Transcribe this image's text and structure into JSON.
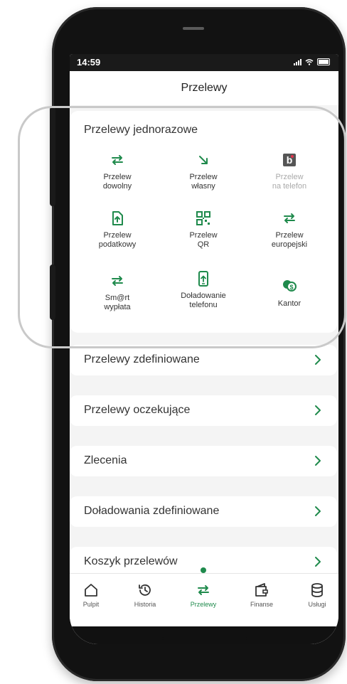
{
  "status": {
    "time": "14:59"
  },
  "header": {
    "title": "Przelewy"
  },
  "one_time": {
    "title": "Przelewy jednorazowe",
    "tiles": [
      {
        "line1": "Przelew",
        "line2": "dowolny",
        "icon": "arrows-exchange-icon",
        "enabled": true
      },
      {
        "line1": "Przelew",
        "line2": "własny",
        "icon": "arrow-down-right-icon",
        "enabled": true
      },
      {
        "line1": "Przelew",
        "line2": "na telefon",
        "icon": "blik-icon",
        "enabled": false
      },
      {
        "line1": "Przelew",
        "line2": "podatkowy",
        "icon": "document-upload-icon",
        "enabled": true
      },
      {
        "line1": "Przelew",
        "line2": "QR",
        "icon": "qr-code-icon",
        "enabled": true
      },
      {
        "line1": "Przelew",
        "line2": "europejski",
        "icon": "arrows-exchange-icon",
        "enabled": true
      },
      {
        "line1": "Sm@rt",
        "line2": "wypłata",
        "icon": "arrows-exchange-icon",
        "enabled": true
      },
      {
        "line1": "Doładowanie",
        "line2": "telefonu",
        "icon": "phone-topup-icon",
        "enabled": true
      },
      {
        "line1": "Kantor",
        "line2": "",
        "icon": "currency-exchange-icon",
        "enabled": true
      }
    ]
  },
  "menu": [
    {
      "label": "Przelewy zdefiniowane"
    },
    {
      "label": "Przelewy oczekujące"
    },
    {
      "label": "Zlecenia"
    },
    {
      "label": "Doładowania zdefiniowane"
    },
    {
      "label": "Koszyk przelewów"
    }
  ],
  "tabs": [
    {
      "label": "Pulpit",
      "icon": "home-icon"
    },
    {
      "label": "Historia",
      "icon": "history-icon"
    },
    {
      "label": "Przelewy",
      "icon": "arrows-exchange-icon",
      "active": true
    },
    {
      "label": "Finanse",
      "icon": "wallet-icon"
    },
    {
      "label": "Usługi",
      "icon": "database-icon"
    }
  ],
  "colors": {
    "accent": "#1f8a4c",
    "disabled": "#aaaaaa",
    "blik": "#555555"
  }
}
